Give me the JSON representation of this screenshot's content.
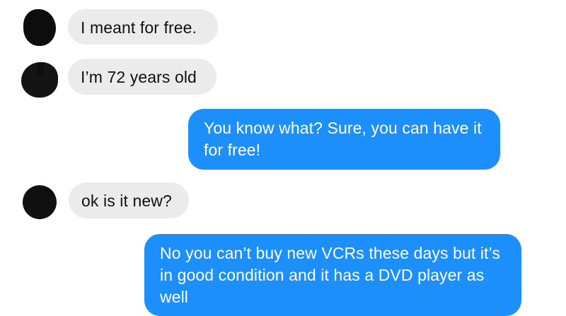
{
  "conversation": {
    "messages": [
      {
        "sender": "other",
        "text": "I meant for free."
      },
      {
        "sender": "other",
        "text": "I’m 72 years old"
      },
      {
        "sender": "me",
        "text": "You know what? Sure, you can have it for free!"
      },
      {
        "sender": "other",
        "text": "ok is it new?"
      },
      {
        "sender": "me",
        "text": "No you can’t buy new VCRs these days but it’s in good condition and it has a DVD player as well"
      }
    ]
  },
  "colors": {
    "incoming_bubble": "#ebebeb",
    "outgoing_bubble": "#1d8ffb",
    "outgoing_text": "#ffffff",
    "incoming_text": "#111111",
    "background": "#ffffff"
  }
}
